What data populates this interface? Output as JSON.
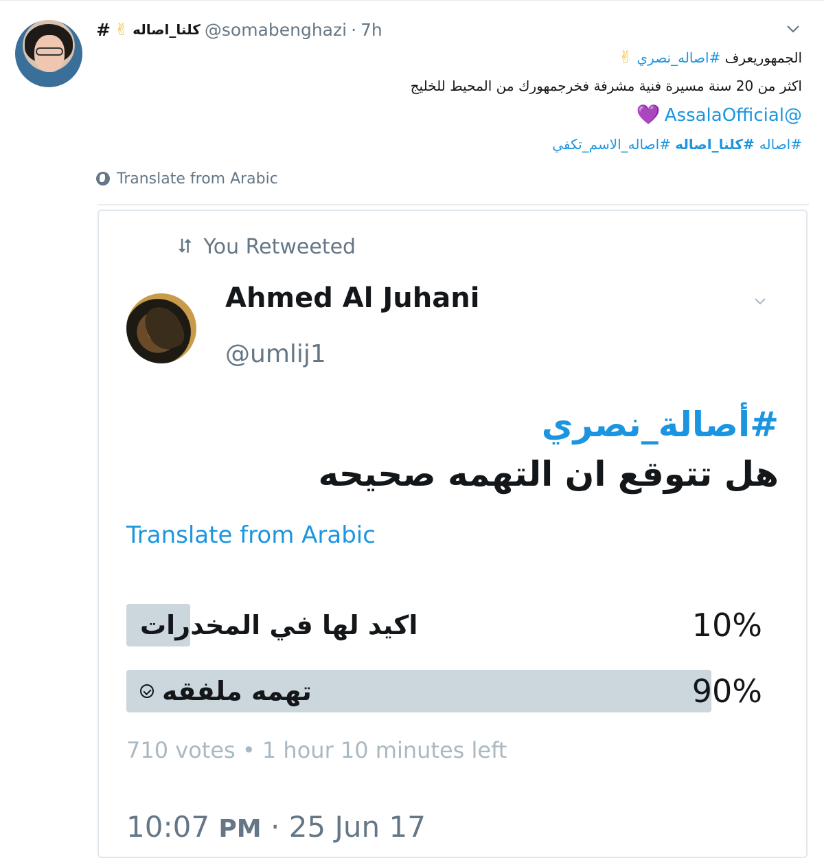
{
  "tweet": {
    "hash_prefix": "#",
    "author_name_ar": "كلنا_اصاله",
    "victory_emoji": "✌",
    "handle": "@somabenghazi",
    "separator": "·",
    "time": "7h",
    "line1_text": "الجمهوريعرف ",
    "line1_hashtag": "#اصاله_نصري",
    "line1_emoji": "✌",
    "line2": "اكثر من 20 سنة مسيرة فنية مشرفة فخرجمهورك من المحيط للخليج",
    "mention": "@AssalaOfficial",
    "heart_emoji": "💜",
    "hashtags": [
      {
        "text": "#اصاله",
        "bold": false
      },
      {
        "text": " #كلنا_اصاله",
        "bold": true
      },
      {
        "text": " #اصاله_الاسم_تكفي",
        "bold": false
      }
    ],
    "translate_label": "Translate from Arabic",
    "icons": {
      "chevron": "chevron-down-icon",
      "globe": "globe-icon"
    }
  },
  "quoted": {
    "retweet_label": "You Retweeted",
    "retweet_icon": "⮃",
    "name": "Ahmed Al Juhani",
    "handle": "@umlij1",
    "hashtag": "#أصالة_نصري",
    "question": "هل تتوقع ان التهمه صحيحه",
    "translate_label": "Translate from Arabic",
    "poll": {
      "options": [
        {
          "label": "اكيد لها في المخدرات",
          "percent": 10,
          "percent_text": "10%",
          "selected": false
        },
        {
          "label": "تهمه ملفقه",
          "percent": 90,
          "percent_text": "90%",
          "selected": true
        }
      ],
      "votes": "710 votes",
      "meta_separator": "•",
      "time_left": "1 hour 10 minutes left"
    },
    "timestamp_time": "10:07",
    "timestamp_ampm": "PM",
    "timestamp_separator": "·",
    "timestamp_date": "25 Jun 17",
    "colors": {
      "link": "#1b95e0",
      "poll_bar": "#ccd6dd",
      "muted": "#657786"
    }
  }
}
